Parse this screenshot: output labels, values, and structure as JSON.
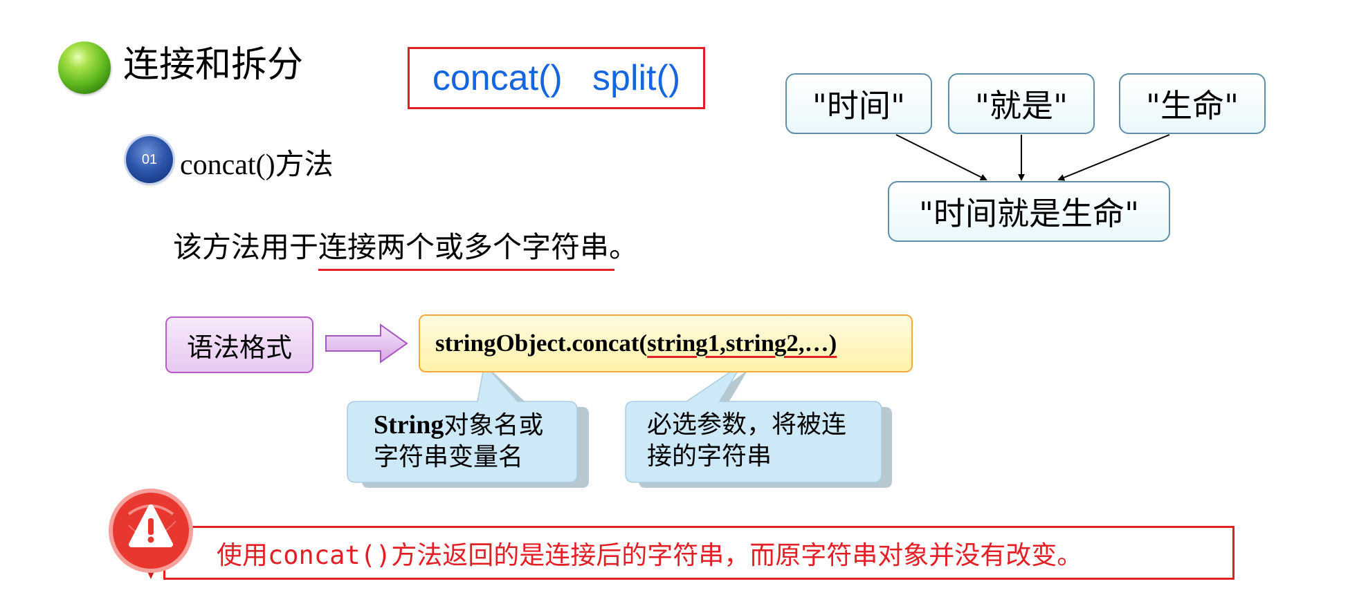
{
  "title": "连接和拆分",
  "methods_box": {
    "text": "concat()   split()"
  },
  "badge": {
    "number": "01"
  },
  "method_heading": "concat()方法",
  "description": {
    "before": "该方法用于",
    "underlined": "连接两个或多个字符串",
    "after": "。"
  },
  "diagram": {
    "parts": [
      "\"时间\"",
      "\"就是\"",
      "\"生命\""
    ],
    "result": "\"时间就是生命\""
  },
  "syntax": {
    "label": "语法格式",
    "code_prefix": "stringObject.concat(",
    "code_params": "string1,string2,…)"
  },
  "callouts": {
    "object": {
      "bold": "String",
      "rest": "对象名或",
      "line2": "字符串变量名"
    },
    "params": {
      "line1": "必选参数，将被连",
      "line2": "接的字符串"
    }
  },
  "warning": {
    "text": "使用concat()方法返回的是连接后的字符串，而原字符串对象并没有改变。"
  },
  "colors": {
    "accent_red": "#e31f26",
    "method_blue": "#1565e0"
  }
}
